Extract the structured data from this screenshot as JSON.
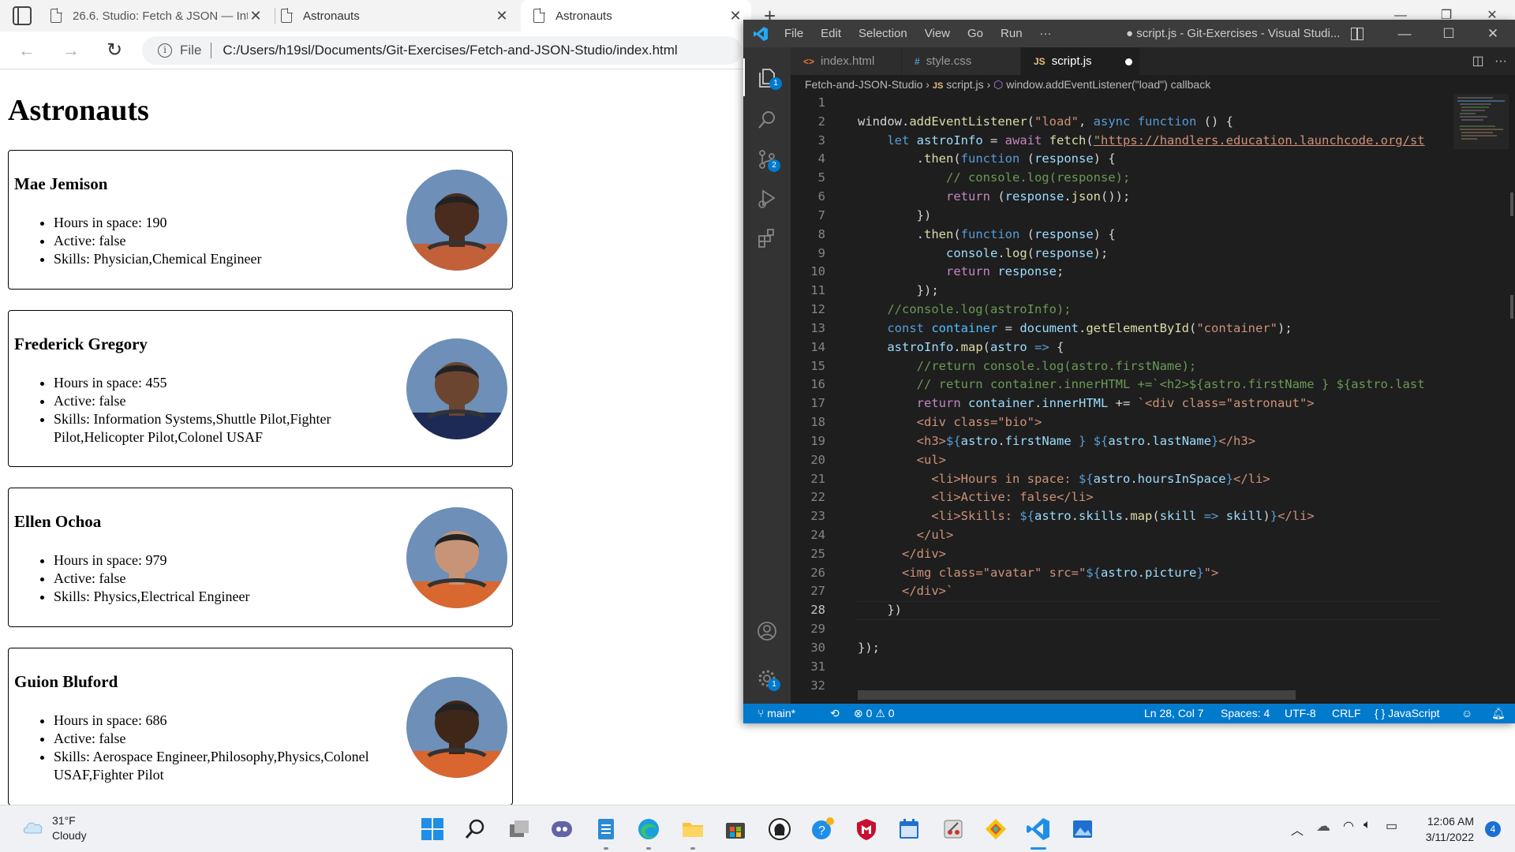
{
  "browser": {
    "tabs": [
      {
        "title": "26.6. Studio: Fetch & JSON — Int"
      },
      {
        "title": "Astronauts"
      },
      {
        "title": "Astronauts"
      }
    ],
    "address": {
      "scheme_label": "File",
      "url": "C:/Users/h19sl/Documents/Git-Exercises/Fetch-and-JSON-Studio/index.html"
    }
  },
  "page": {
    "heading": "Astronauts",
    "astronauts": [
      {
        "name": "Mae Jemison",
        "hours": "Hours in space: 190",
        "active": "Active: false",
        "skills": "Skills: Physician,Chemical Engineer",
        "skin": "#4a2c1e",
        "suit": "#c2603a"
      },
      {
        "name": "Frederick Gregory",
        "hours": "Hours in space: 455",
        "active": "Active: false",
        "skills": "Skills: Information Systems,Shuttle Pilot,Fighter Pilot,Helicopter Pilot,Colonel USAF",
        "skin": "#6b4530",
        "suit": "#1d2a55"
      },
      {
        "name": "Ellen Ochoa",
        "hours": "Hours in space: 979",
        "active": "Active: false",
        "skills": "Skills: Physics,Electrical Engineer",
        "skin": "#c89478",
        "suit": "#d86830"
      },
      {
        "name": "Guion Bluford",
        "hours": "Hours in space: 686",
        "active": "Active: false",
        "skills": "Skills: Aerospace Engineer,Philosophy,Physics,Colonel USAF,Fighter Pilot",
        "skin": "#3e2619",
        "suit": "#d8662e"
      }
    ]
  },
  "vscode": {
    "menu": [
      "File",
      "Edit",
      "Selection",
      "View",
      "Go",
      "Run",
      "···"
    ],
    "title": "● script.js - Git-Exercises - Visual Studi...",
    "tabs": [
      {
        "icon": "<>",
        "label": "index.html"
      },
      {
        "icon": "#",
        "label": "style.css"
      },
      {
        "icon": "JS",
        "label": "script.js"
      }
    ],
    "breadcrumb": {
      "folder": "Fetch-and-JSON-Studio",
      "file_icon": "JS",
      "file": "script.js",
      "symbol": "window.addEventListener(\"load\") callback"
    },
    "activity_badges": {
      "explorer": "1",
      "scm": "2",
      "settings": "1"
    },
    "current_line": 28,
    "code": [
      [],
      [
        [
          "window",
          "f"
        ],
        [
          ".",
          ""
        ],
        [
          "addEventListener",
          "y"
        ],
        [
          "(",
          ""
        ],
        [
          "\"load\"",
          "s"
        ],
        [
          ", ",
          ""
        ],
        [
          "async",
          "k"
        ],
        [
          " ",
          ""
        ],
        [
          "function",
          "k"
        ],
        [
          " () {",
          ""
        ]
      ],
      [
        [
          "    ",
          ""
        ],
        [
          "let",
          "k"
        ],
        [
          " ",
          ""
        ],
        [
          "astroInfo",
          "v"
        ],
        [
          " = ",
          ""
        ],
        [
          "await",
          "p"
        ],
        [
          " ",
          ""
        ],
        [
          "fetch",
          "y"
        ],
        [
          "(",
          ""
        ],
        [
          "\"https://handlers.education.launchcode.org/st",
          "u"
        ]
      ],
      [
        [
          "        .",
          ""
        ],
        [
          "then",
          "y"
        ],
        [
          "(",
          ""
        ],
        [
          "function",
          "k"
        ],
        [
          " (",
          ""
        ],
        [
          "response",
          "v"
        ],
        [
          ") {",
          ""
        ]
      ],
      [
        [
          "            ",
          ""
        ],
        [
          "// console.log(response);",
          "c"
        ]
      ],
      [
        [
          "            ",
          ""
        ],
        [
          "return",
          "p"
        ],
        [
          " (",
          ""
        ],
        [
          "response",
          "v"
        ],
        [
          ".",
          ""
        ],
        [
          "json",
          "y"
        ],
        [
          "());",
          ""
        ]
      ],
      [
        [
          "        })",
          ""
        ]
      ],
      [
        [
          "        .",
          ""
        ],
        [
          "then",
          "y"
        ],
        [
          "(",
          ""
        ],
        [
          "function",
          "k"
        ],
        [
          " (",
          ""
        ],
        [
          "response",
          "v"
        ],
        [
          ") {",
          ""
        ]
      ],
      [
        [
          "            ",
          ""
        ],
        [
          "console",
          "v"
        ],
        [
          ".",
          ""
        ],
        [
          "log",
          "y"
        ],
        [
          "(",
          ""
        ],
        [
          "response",
          "v"
        ],
        [
          ");",
          ""
        ]
      ],
      [
        [
          "            ",
          ""
        ],
        [
          "return",
          "p"
        ],
        [
          " ",
          ""
        ],
        [
          "response",
          "v"
        ],
        [
          ";",
          ""
        ]
      ],
      [
        [
          "        });",
          ""
        ]
      ],
      [
        [
          "    ",
          ""
        ],
        [
          "//console.log(astroInfo);",
          "c"
        ]
      ],
      [
        [
          "    ",
          ""
        ],
        [
          "const",
          "k"
        ],
        [
          " ",
          ""
        ],
        [
          "container",
          "t"
        ],
        [
          " = ",
          ""
        ],
        [
          "document",
          "v"
        ],
        [
          ".",
          ""
        ],
        [
          "getElementById",
          "y"
        ],
        [
          "(",
          ""
        ],
        [
          "\"container\"",
          "s"
        ],
        [
          ");",
          ""
        ]
      ],
      [
        [
          "    ",
          ""
        ],
        [
          "astroInfo",
          "v"
        ],
        [
          ".",
          ""
        ],
        [
          "map",
          "y"
        ],
        [
          "(",
          ""
        ],
        [
          "astro",
          "v"
        ],
        [
          " ",
          ""
        ],
        [
          "=>",
          "k"
        ],
        [
          " {",
          ""
        ]
      ],
      [
        [
          "        ",
          ""
        ],
        [
          "//return console.log(astro.firstName);",
          "c"
        ]
      ],
      [
        [
          "        ",
          ""
        ],
        [
          "// return container.innerHTML +=`<h2>${astro.firstName } ${astro.last",
          "c"
        ]
      ],
      [
        [
          "        ",
          ""
        ],
        [
          "return",
          "p"
        ],
        [
          " ",
          ""
        ],
        [
          "container",
          "v"
        ],
        [
          ".",
          ""
        ],
        [
          "innerHTML",
          "v"
        ],
        [
          " += ",
          ""
        ],
        [
          "`<div class=\"astronaut\">",
          "s"
        ]
      ],
      [
        [
          "        ",
          ""
        ],
        [
          "<div class=\"bio\">",
          "s"
        ]
      ],
      [
        [
          "        ",
          ""
        ],
        [
          "<h3>",
          "s"
        ],
        [
          "${",
          "k"
        ],
        [
          "astro",
          "v"
        ],
        [
          ".",
          ""
        ],
        [
          "firstName",
          "v"
        ],
        [
          " }",
          "k"
        ],
        [
          " ",
          "s"
        ],
        [
          "${",
          "k"
        ],
        [
          "astro",
          "v"
        ],
        [
          ".",
          ""
        ],
        [
          "lastName",
          "v"
        ],
        [
          "}",
          "k"
        ],
        [
          "</h3>",
          "s"
        ]
      ],
      [
        [
          "        ",
          ""
        ],
        [
          "<ul>",
          "s"
        ]
      ],
      [
        [
          "          ",
          ""
        ],
        [
          "<li>Hours in space: ",
          "s"
        ],
        [
          "${",
          "k"
        ],
        [
          "astro",
          "v"
        ],
        [
          ".",
          ""
        ],
        [
          "hoursInSpace",
          "v"
        ],
        [
          "}",
          "k"
        ],
        [
          "</li>",
          "s"
        ]
      ],
      [
        [
          "          ",
          ""
        ],
        [
          "<li>Active: false</li>",
          "s"
        ]
      ],
      [
        [
          "          ",
          ""
        ],
        [
          "<li>Skills: ",
          "s"
        ],
        [
          "${",
          "k"
        ],
        [
          "astro",
          "v"
        ],
        [
          ".",
          ""
        ],
        [
          "skills",
          "v"
        ],
        [
          ".",
          ""
        ],
        [
          "map",
          "y"
        ],
        [
          "(",
          ""
        ],
        [
          "skill",
          "v"
        ],
        [
          " ",
          ""
        ],
        [
          "=>",
          "k"
        ],
        [
          " ",
          ""
        ],
        [
          "skill",
          "v"
        ],
        [
          ")",
          ""
        ],
        [
          "}",
          "k"
        ],
        [
          "</li>",
          "s"
        ]
      ],
      [
        [
          "        ",
          ""
        ],
        [
          "</ul>",
          "s"
        ]
      ],
      [
        [
          "      ",
          ""
        ],
        [
          "</div>",
          "s"
        ]
      ],
      [
        [
          "      ",
          ""
        ],
        [
          "<img class=\"avatar\" src=\"",
          "s"
        ],
        [
          "${",
          "k"
        ],
        [
          "astro",
          "v"
        ],
        [
          ".",
          ""
        ],
        [
          "picture",
          "v"
        ],
        [
          "}",
          "k"
        ],
        [
          "\">",
          "s"
        ]
      ],
      [
        [
          "      ",
          ""
        ],
        [
          "</div>`",
          "s"
        ]
      ],
      [
        [
          "    })",
          ""
        ]
      ],
      [],
      [
        [
          "});",
          ""
        ]
      ],
      [],
      []
    ],
    "status": {
      "branch": "main*",
      "errors": "0",
      "warnings": "0",
      "position": "Ln 28, Col 7",
      "spaces": "Spaces: 4",
      "encoding": "UTF-8",
      "eol": "CRLF",
      "language": "JavaScript"
    }
  },
  "taskbar": {
    "weather": {
      "temp": "31°F",
      "condition": "Cloudy"
    },
    "time": "12:06 AM",
    "date": "3/11/2022",
    "notifications": "4"
  },
  "colors": {
    "k": "#569cd6",
    "p": "#c586c0",
    "y": "#dcdcaa",
    "v": "#9cdcfe",
    "t": "#4fc1ff",
    "s": "#ce9178",
    "c": "#6a9955",
    "u": "#ce9178",
    "f": "#d4d4d4",
    "": "#d4d4d4"
  }
}
